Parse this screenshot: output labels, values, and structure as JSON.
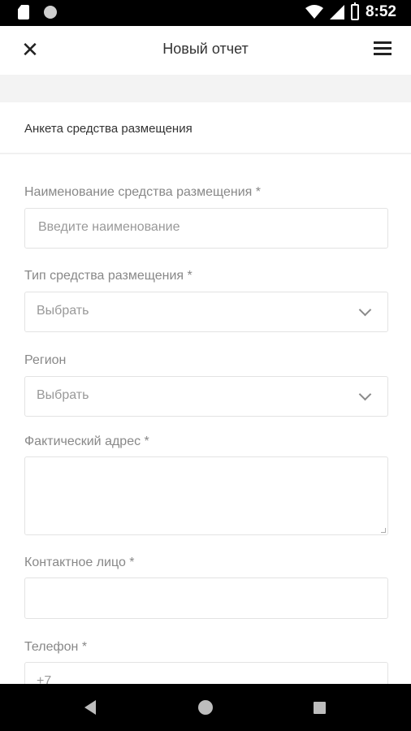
{
  "status_bar": {
    "time": "8:52"
  },
  "header": {
    "title": "Новый отчет"
  },
  "section": {
    "title": "Анкета средства размещения"
  },
  "form": {
    "name": {
      "label": "Наименование средства размещения *",
      "placeholder": "Введите наименование"
    },
    "type": {
      "label": "Тип средства размещения *",
      "value": "Выбрать"
    },
    "region": {
      "label": "Регион",
      "value": "Выбрать"
    },
    "address": {
      "label": "Фактический адрес *",
      "value": ""
    },
    "contact": {
      "label": "Контактное лицо *",
      "value": ""
    },
    "phone": {
      "label": "Телефон *",
      "value": "+7"
    }
  }
}
